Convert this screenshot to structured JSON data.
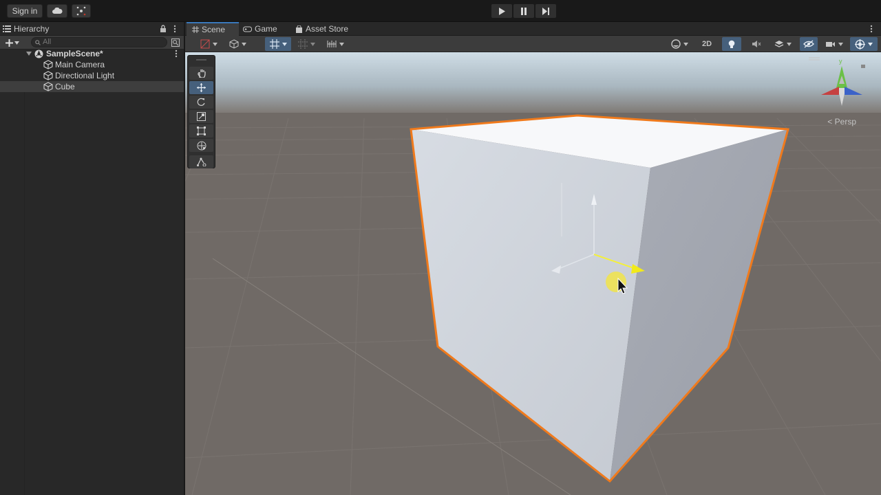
{
  "topbar": {
    "sign_in_label": "Sign in",
    "cloud_icon": "cloud-icon",
    "collab_icon": "collab-icon",
    "play_controls": [
      "play-icon",
      "pause-icon",
      "step-icon"
    ]
  },
  "hierarchy": {
    "tab_label": "Hierarchy",
    "search_placeholder": "All",
    "scene_name": "SampleScene*",
    "items": [
      {
        "label": "Main Camera"
      },
      {
        "label": "Directional Light"
      },
      {
        "label": "Cube"
      }
    ]
  },
  "scene_tabs": {
    "scene": "Scene",
    "game": "Game",
    "asset_store": "Asset Store"
  },
  "scene_toolbar": {
    "mode_2d": "2D"
  },
  "viewport": {
    "projection_label": "Persp"
  },
  "colors": {
    "selection_outline": "#f07a1c",
    "accent": "#3a79bb"
  }
}
